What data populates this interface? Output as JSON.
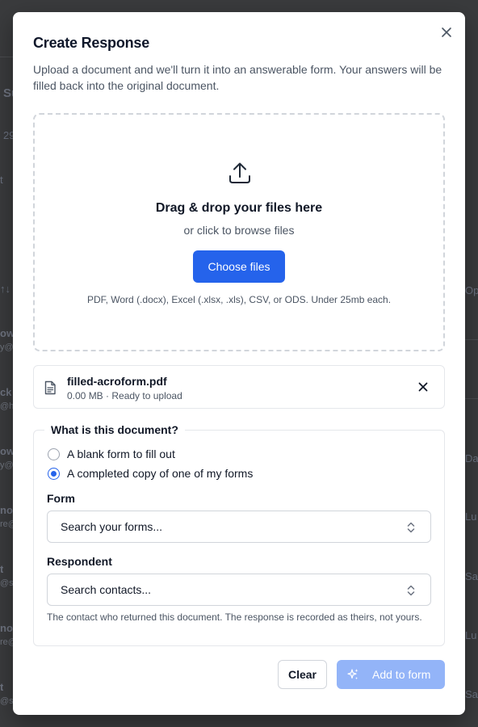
{
  "background": {
    "fragments": [
      "Su",
      "29",
      "t",
      "↑↓",
      "Opi",
      "ow",
      "y@c",
      "ck",
      "@ho",
      "ow",
      "y@c",
      "Dal",
      "no",
      "re@",
      "Lu",
      "t",
      "@sa",
      "Sab",
      "no",
      "re@",
      "Lu",
      "t",
      "@sa",
      "Sab"
    ]
  },
  "modal": {
    "title": "Create Response",
    "description": "Upload a document and we'll turn it into an answerable form. Your answers will be filled back into the original document.",
    "close_icon": "close-icon"
  },
  "dropzone": {
    "icon": "upload-icon",
    "title": "Drag & drop your files here",
    "subtitle": "or click to browse files",
    "button_label": "Choose files",
    "hint": "PDF, Word (.docx), Excel (.xlsx, .xls), CSV, or ODS. Under 25mb each."
  },
  "file": {
    "icon": "document-icon",
    "name": "filled-acroform.pdf",
    "meta": "0.00 MB · Ready to upload",
    "remove_icon": "close-icon"
  },
  "document_type": {
    "legend": "What is this document?",
    "options": [
      {
        "label": "A blank form to fill out",
        "checked": false
      },
      {
        "label": "A completed copy of one of my forms",
        "checked": true
      }
    ]
  },
  "form_field": {
    "label": "Form",
    "placeholder": "Search your forms..."
  },
  "respondent_field": {
    "label": "Respondent",
    "placeholder": "Search contacts...",
    "help": "The contact who returned this document. The response is recorded as theirs, not yours."
  },
  "footer": {
    "clear_label": "Clear",
    "add_label": "Add to form",
    "add_icon": "sparkle-icon"
  },
  "colors": {
    "accent": "#2563eb",
    "accent_disabled": "#93b4f8",
    "overlay": "#3a3b3d"
  }
}
